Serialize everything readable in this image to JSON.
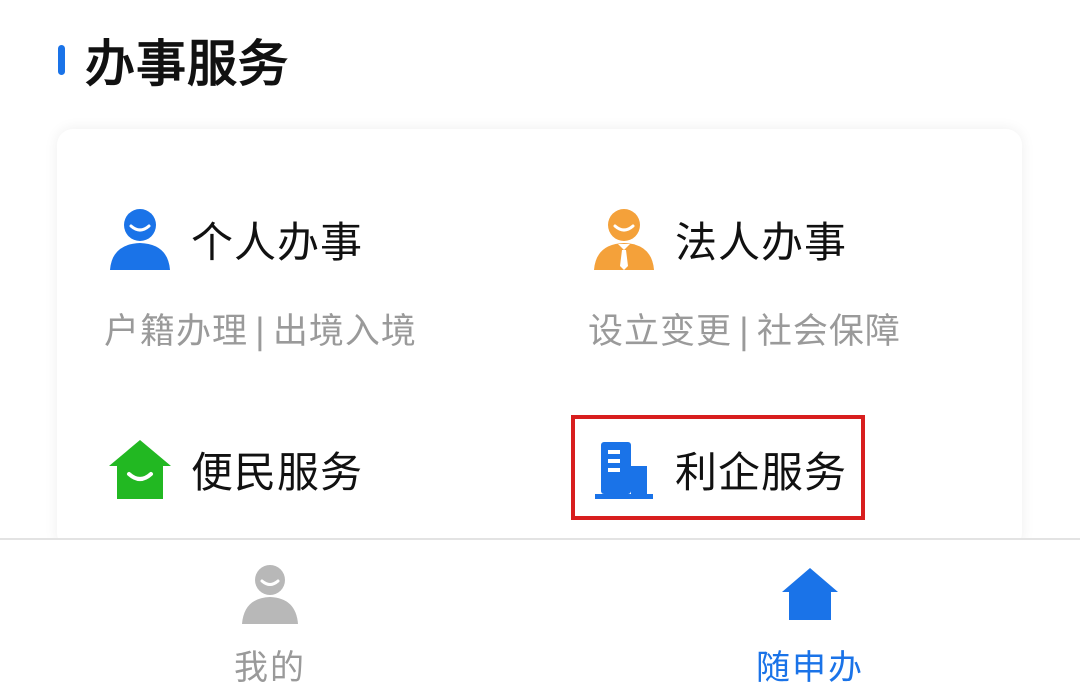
{
  "section": {
    "title": "办事服务"
  },
  "services": {
    "personal": {
      "label": "个人办事",
      "sub_items": [
        "户籍办理",
        "出境入境"
      ],
      "separator": "|"
    },
    "corporate": {
      "label": "法人办事",
      "sub_items": [
        "设立变更",
        "社会保障"
      ],
      "separator": "|"
    },
    "convenience": {
      "label": "便民服务"
    },
    "enterprise": {
      "label": "利企服务",
      "highlighted": true
    }
  },
  "tabbar": {
    "mine_label": "我的",
    "home_label": "随申办",
    "active_tab": "随申办"
  },
  "icons": {
    "personal": "person-smile-icon",
    "corporate": "person-tie-icon",
    "convenience": "house-smile-icon",
    "enterprise": "building-icon",
    "mine": "person-icon",
    "home": "home-icon"
  },
  "colors": {
    "accent_blue": "#1a73e8",
    "orange": "#f4a13a",
    "green": "#22b822",
    "inactive_gray": "#b8b8b8",
    "highlight_red": "#d81e1e",
    "subtext_gray": "#9a9a9a"
  }
}
